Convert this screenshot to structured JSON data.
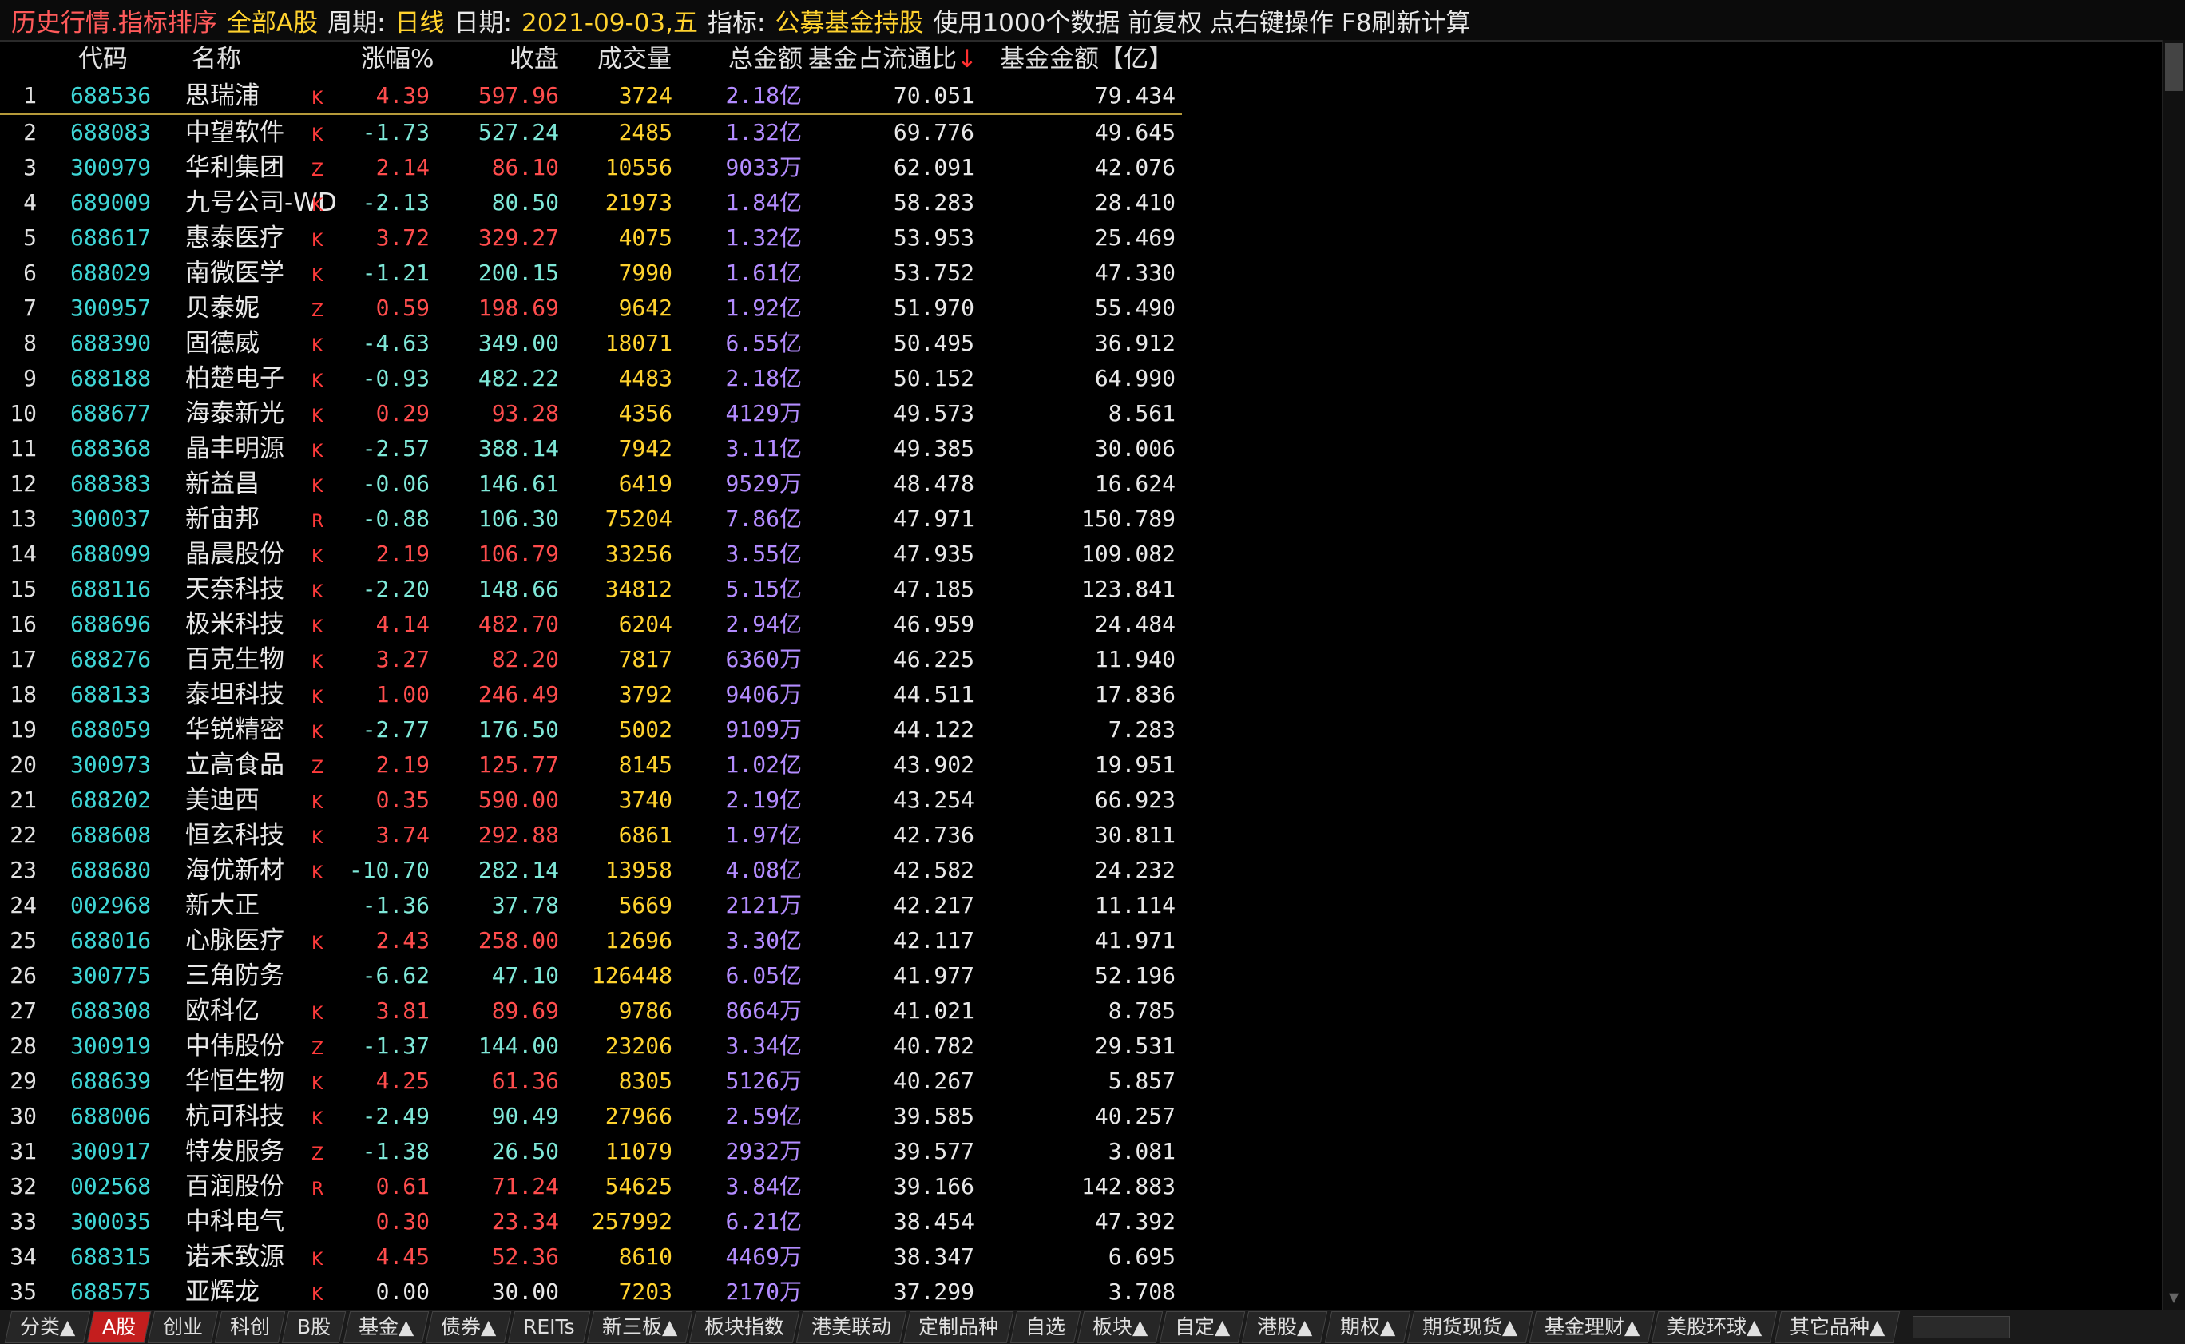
{
  "title": {
    "segments": [
      {
        "text": "历史行情.指标排序",
        "cls": "t-red"
      },
      {
        "text": "全部A股",
        "cls": "t-yel"
      },
      {
        "text": "周期:",
        "cls": "t-wht"
      },
      {
        "text": "日线",
        "cls": "t-yel"
      },
      {
        "text": "日期:",
        "cls": "t-wht"
      },
      {
        "text": "2021-09-03,五",
        "cls": "t-yel"
      },
      {
        "text": "指标:",
        "cls": "t-wht"
      },
      {
        "text": "公募基金持股",
        "cls": "t-yel"
      },
      {
        "text": "使用1000个数据 前复权 点右键操作 F8刷新计算",
        "cls": "t-wht"
      }
    ]
  },
  "columns": {
    "code": "代码",
    "name": "名称",
    "chg": "涨幅%",
    "close": "收盘",
    "vol": "成交量",
    "amt": "总金额",
    "ratio": "基金占流通比",
    "ratio_arrow": "↓",
    "fund": "基金金额【亿】"
  },
  "rows": [
    {
      "idx": "1",
      "code": "688536",
      "name": "思瑞浦",
      "tag": "K",
      "chg": "4.39",
      "close": "597.96",
      "vol": "3724",
      "amt": "2.18",
      "unit": "亿",
      "ratio": "70.051",
      "fund": "79.434"
    },
    {
      "idx": "2",
      "code": "688083",
      "name": "中望软件",
      "tag": "K",
      "chg": "-1.73",
      "close": "527.24",
      "vol": "2485",
      "amt": "1.32",
      "unit": "亿",
      "ratio": "69.776",
      "fund": "49.645"
    },
    {
      "idx": "3",
      "code": "300979",
      "name": "华利集团",
      "tag": "Z",
      "chg": "2.14",
      "close": "86.10",
      "vol": "10556",
      "amt": "9033",
      "unit": "万",
      "ratio": "62.091",
      "fund": "42.076"
    },
    {
      "idx": "4",
      "code": "689009",
      "name": "九号公司-WD",
      "tag": "K",
      "chg": "-2.13",
      "close": "80.50",
      "vol": "21973",
      "amt": "1.84",
      "unit": "亿",
      "ratio": "58.283",
      "fund": "28.410"
    },
    {
      "idx": "5",
      "code": "688617",
      "name": "惠泰医疗",
      "tag": "K",
      "chg": "3.72",
      "close": "329.27",
      "vol": "4075",
      "amt": "1.32",
      "unit": "亿",
      "ratio": "53.953",
      "fund": "25.469"
    },
    {
      "idx": "6",
      "code": "688029",
      "name": "南微医学",
      "tag": "K",
      "chg": "-1.21",
      "close": "200.15",
      "vol": "7990",
      "amt": "1.61",
      "unit": "亿",
      "ratio": "53.752",
      "fund": "47.330"
    },
    {
      "idx": "7",
      "code": "300957",
      "name": "贝泰妮",
      "tag": "Z",
      "chg": "0.59",
      "close": "198.69",
      "vol": "9642",
      "amt": "1.92",
      "unit": "亿",
      "ratio": "51.970",
      "fund": "55.490"
    },
    {
      "idx": "8",
      "code": "688390",
      "name": "固德威",
      "tag": "K",
      "chg": "-4.63",
      "close": "349.00",
      "vol": "18071",
      "amt": "6.55",
      "unit": "亿",
      "ratio": "50.495",
      "fund": "36.912"
    },
    {
      "idx": "9",
      "code": "688188",
      "name": "柏楚电子",
      "tag": "K",
      "chg": "-0.93",
      "close": "482.22",
      "vol": "4483",
      "amt": "2.18",
      "unit": "亿",
      "ratio": "50.152",
      "fund": "64.990"
    },
    {
      "idx": "10",
      "code": "688677",
      "name": "海泰新光",
      "tag": "K",
      "chg": "0.29",
      "close": "93.28",
      "vol": "4356",
      "amt": "4129",
      "unit": "万",
      "ratio": "49.573",
      "fund": "8.561"
    },
    {
      "idx": "11",
      "code": "688368",
      "name": "晶丰明源",
      "tag": "K",
      "chg": "-2.57",
      "close": "388.14",
      "vol": "7942",
      "amt": "3.11",
      "unit": "亿",
      "ratio": "49.385",
      "fund": "30.006"
    },
    {
      "idx": "12",
      "code": "688383",
      "name": "新益昌",
      "tag": "K",
      "chg": "-0.06",
      "close": "146.61",
      "vol": "6419",
      "amt": "9529",
      "unit": "万",
      "ratio": "48.478",
      "fund": "16.624"
    },
    {
      "idx": "13",
      "code": "300037",
      "name": "新宙邦",
      "tag": "R",
      "chg": "-0.88",
      "close": "106.30",
      "vol": "75204",
      "amt": "7.86",
      "unit": "亿",
      "ratio": "47.971",
      "fund": "150.789"
    },
    {
      "idx": "14",
      "code": "688099",
      "name": "晶晨股份",
      "tag": "K",
      "chg": "2.19",
      "close": "106.79",
      "vol": "33256",
      "amt": "3.55",
      "unit": "亿",
      "ratio": "47.935",
      "fund": "109.082"
    },
    {
      "idx": "15",
      "code": "688116",
      "name": "天奈科技",
      "tag": "K",
      "chg": "-2.20",
      "close": "148.66",
      "vol": "34812",
      "amt": "5.15",
      "unit": "亿",
      "ratio": "47.185",
      "fund": "123.841"
    },
    {
      "idx": "16",
      "code": "688696",
      "name": "极米科技",
      "tag": "K",
      "chg": "4.14",
      "close": "482.70",
      "vol": "6204",
      "amt": "2.94",
      "unit": "亿",
      "ratio": "46.959",
      "fund": "24.484"
    },
    {
      "idx": "17",
      "code": "688276",
      "name": "百克生物",
      "tag": "K",
      "chg": "3.27",
      "close": "82.20",
      "vol": "7817",
      "amt": "6360",
      "unit": "万",
      "ratio": "46.225",
      "fund": "11.940"
    },
    {
      "idx": "18",
      "code": "688133",
      "name": "泰坦科技",
      "tag": "K",
      "chg": "1.00",
      "close": "246.49",
      "vol": "3792",
      "amt": "9406",
      "unit": "万",
      "ratio": "44.511",
      "fund": "17.836"
    },
    {
      "idx": "19",
      "code": "688059",
      "name": "华锐精密",
      "tag": "K",
      "chg": "-2.77",
      "close": "176.50",
      "vol": "5002",
      "amt": "9109",
      "unit": "万",
      "ratio": "44.122",
      "fund": "7.283"
    },
    {
      "idx": "20",
      "code": "300973",
      "name": "立高食品",
      "tag": "Z",
      "chg": "2.19",
      "close": "125.77",
      "vol": "8145",
      "amt": "1.02",
      "unit": "亿",
      "ratio": "43.902",
      "fund": "19.951"
    },
    {
      "idx": "21",
      "code": "688202",
      "name": "美迪西",
      "tag": "K",
      "chg": "0.35",
      "close": "590.00",
      "vol": "3740",
      "amt": "2.19",
      "unit": "亿",
      "ratio": "43.254",
      "fund": "66.923"
    },
    {
      "idx": "22",
      "code": "688608",
      "name": "恒玄科技",
      "tag": "K",
      "chg": "3.74",
      "close": "292.88",
      "vol": "6861",
      "amt": "1.97",
      "unit": "亿",
      "ratio": "42.736",
      "fund": "30.811"
    },
    {
      "idx": "23",
      "code": "688680",
      "name": "海优新材",
      "tag": "K",
      "chg": "-10.70",
      "close": "282.14",
      "vol": "13958",
      "amt": "4.08",
      "unit": "亿",
      "ratio": "42.582",
      "fund": "24.232"
    },
    {
      "idx": "24",
      "code": "002968",
      "name": "新大正",
      "tag": "",
      "chg": "-1.36",
      "close": "37.78",
      "vol": "5669",
      "amt": "2121",
      "unit": "万",
      "ratio": "42.217",
      "fund": "11.114"
    },
    {
      "idx": "25",
      "code": "688016",
      "name": "心脉医疗",
      "tag": "K",
      "chg": "2.43",
      "close": "258.00",
      "vol": "12696",
      "amt": "3.30",
      "unit": "亿",
      "ratio": "42.117",
      "fund": "41.971"
    },
    {
      "idx": "26",
      "code": "300775",
      "name": "三角防务",
      "tag": "",
      "chg": "-6.62",
      "close": "47.10",
      "vol": "126448",
      "amt": "6.05",
      "unit": "亿",
      "ratio": "41.977",
      "fund": "52.196"
    },
    {
      "idx": "27",
      "code": "688308",
      "name": "欧科亿",
      "tag": "K",
      "chg": "3.81",
      "close": "89.69",
      "vol": "9786",
      "amt": "8664",
      "unit": "万",
      "ratio": "41.021",
      "fund": "8.785"
    },
    {
      "idx": "28",
      "code": "300919",
      "name": "中伟股份",
      "tag": "Z",
      "chg": "-1.37",
      "close": "144.00",
      "vol": "23206",
      "amt": "3.34",
      "unit": "亿",
      "ratio": "40.782",
      "fund": "29.531"
    },
    {
      "idx": "29",
      "code": "688639",
      "name": "华恒生物",
      "tag": "K",
      "chg": "4.25",
      "close": "61.36",
      "vol": "8305",
      "amt": "5126",
      "unit": "万",
      "ratio": "40.267",
      "fund": "5.857"
    },
    {
      "idx": "30",
      "code": "688006",
      "name": "杭可科技",
      "tag": "K",
      "chg": "-2.49",
      "close": "90.49",
      "vol": "27966",
      "amt": "2.59",
      "unit": "亿",
      "ratio": "39.585",
      "fund": "40.257"
    },
    {
      "idx": "31",
      "code": "300917",
      "name": "特发服务",
      "tag": "Z",
      "chg": "-1.38",
      "close": "26.50",
      "vol": "11079",
      "amt": "2932",
      "unit": "万",
      "ratio": "39.577",
      "fund": "3.081"
    },
    {
      "idx": "32",
      "code": "002568",
      "name": "百润股份",
      "tag": "R",
      "chg": "0.61",
      "close": "71.24",
      "vol": "54625",
      "amt": "3.84",
      "unit": "亿",
      "ratio": "39.166",
      "fund": "142.883"
    },
    {
      "idx": "33",
      "code": "300035",
      "name": "中科电气",
      "tag": "",
      "chg": "0.30",
      "close": "23.34",
      "vol": "257992",
      "amt": "6.21",
      "unit": "亿",
      "ratio": "38.454",
      "fund": "47.392"
    },
    {
      "idx": "34",
      "code": "688315",
      "name": "诺禾致源",
      "tag": "K",
      "chg": "4.45",
      "close": "52.36",
      "vol": "8610",
      "amt": "4469",
      "unit": "万",
      "ratio": "38.347",
      "fund": "6.695"
    },
    {
      "idx": "35",
      "code": "688575",
      "name": "亚辉龙",
      "tag": "K",
      "chg": "0.00",
      "close": "30.00",
      "vol": "7203",
      "amt": "2170",
      "unit": "万",
      "ratio": "37.299",
      "fund": "3.708"
    }
  ],
  "tabs": [
    {
      "label": "分类▲",
      "active": false
    },
    {
      "label": "A股",
      "active": true
    },
    {
      "label": "创业",
      "active": false
    },
    {
      "label": "科创",
      "active": false
    },
    {
      "label": "B股",
      "active": false
    },
    {
      "label": "基金▲",
      "active": false
    },
    {
      "label": "债券▲",
      "active": false
    },
    {
      "label": "REITs",
      "active": false
    },
    {
      "label": "新三板▲",
      "active": false
    },
    {
      "label": "板块指数",
      "active": false
    },
    {
      "label": "港美联动",
      "active": false
    },
    {
      "label": "定制品种",
      "active": false
    },
    {
      "label": "自选",
      "active": false
    },
    {
      "label": "板块▲",
      "active": false
    },
    {
      "label": "自定▲",
      "active": false
    },
    {
      "label": "港股▲",
      "active": false
    },
    {
      "label": "期权▲",
      "active": false
    },
    {
      "label": "期货现货▲",
      "active": false
    },
    {
      "label": "基金理财▲",
      "active": false
    },
    {
      "label": "美股环球▲",
      "active": false
    },
    {
      "label": "其它品种▲",
      "active": false
    }
  ]
}
